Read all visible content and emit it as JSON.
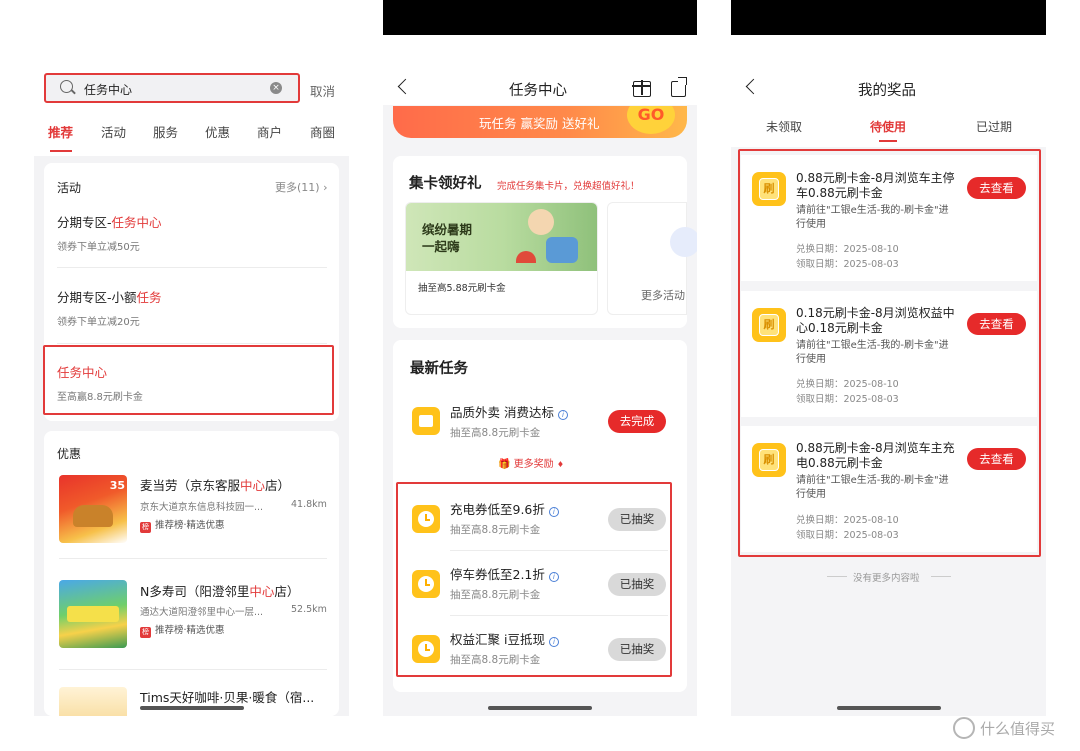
{
  "panel1": {
    "search": {
      "query": "任务中心",
      "cancel": "取消"
    },
    "tabs": [
      "推荐",
      "活动",
      "服务",
      "优惠",
      "商户",
      "商圈"
    ],
    "activity": {
      "title": "活动",
      "more": "更多(11)",
      "items": [
        {
          "title_a": "分期专区-",
          "title_hl": "任务中心",
          "title_b": "",
          "sub": "领券下单立减50元"
        },
        {
          "title_a": "分期专区-小额",
          "title_hl": "任务",
          "title_b": "",
          "sub": "领券下单立减20元"
        },
        {
          "title_a": "",
          "title_hl": "任务中心",
          "title_b": "",
          "sub": "至高赢8.8元刷卡金"
        }
      ]
    },
    "discount": {
      "title": "优惠",
      "shops": [
        {
          "name_a": "麦当劳（京东客服",
          "name_hl": "中心",
          "name_b": "店）",
          "addr": "京东大道京东信息科技园一...",
          "dist": "41.8km",
          "tag": "推荐榜·精选优惠",
          "tag_icon": "榜"
        },
        {
          "name_a": "N多寿司（阳澄邻里",
          "name_hl": "中心",
          "name_b": "店）",
          "addr": "通达大道阳澄邻里中心一层...",
          "dist": "52.5km",
          "tag": "推荐榜·精选优惠",
          "tag_icon": "榜"
        },
        {
          "name_a": "Tims天好咖啡·贝果·暖食（宿...",
          "name_hl": "",
          "name_b": "",
          "addr": "",
          "dist": "",
          "tag": "",
          "tag_icon": ""
        }
      ]
    }
  },
  "panel2": {
    "nav_title": "任务中心",
    "banner": "玩任务 赢奖励 送好礼",
    "banner_go": "GO",
    "collect": {
      "title": "集卡领好礼",
      "subtitle": "完成任务集卡片，兑换超值好礼！",
      "card_title_1": "缤纷暑期",
      "card_title_2": "一起嗨",
      "card_sub": "抽至高5.88元刷卡金",
      "more": "更多活动"
    },
    "latest": {
      "title": "最新任务",
      "tasks": [
        {
          "name": "品质外卖 消费达标",
          "sub": "抽至高8.8元刷卡金",
          "button": "去完成",
          "state": "active",
          "icon": "bag-icon"
        },
        {
          "name": "充电券低至9.6折",
          "sub": "抽至高8.8元刷卡金",
          "button": "已抽奖",
          "state": "done",
          "icon": "clock-icon"
        },
        {
          "name": "停车券低至2.1折",
          "sub": "抽至高8.8元刷卡金",
          "button": "已抽奖",
          "state": "done",
          "icon": "clock-icon"
        },
        {
          "name": "权益汇聚 i豆抵现",
          "sub": "抽至高8.8元刷卡金",
          "button": "已抽奖",
          "state": "done",
          "icon": "clock-icon"
        }
      ],
      "more_rewards": "更多奖励"
    }
  },
  "panel3": {
    "nav_title": "我的奖品",
    "tabs": [
      "未领取",
      "待使用",
      "已过期"
    ],
    "active_tab": 1,
    "prizes": [
      {
        "title": "0.88元刷卡金-8月浏览车主停车0.88元刷卡金",
        "desc": "请前往\"工银e生活-我的-刷卡金\"进行使用",
        "exchange": "兑换日期：2025-08-10",
        "receive": "领取日期：2025-08-03",
        "button": "去查看",
        "icon": "刷"
      },
      {
        "title": "0.18元刷卡金-8月浏览权益中心0.18元刷卡金",
        "desc": "请前往\"工银e生活-我的-刷卡金\"进行使用",
        "exchange": "兑换日期：2025-08-10",
        "receive": "领取日期：2025-08-03",
        "button": "去查看",
        "icon": "刷"
      },
      {
        "title": "0.88元刷卡金-8月浏览车主充电0.88元刷卡金",
        "desc": "请前往\"工银e生活-我的-刷卡金\"进行使用",
        "exchange": "兑换日期：2025-08-10",
        "receive": "领取日期：2025-08-03",
        "button": "去查看",
        "icon": "刷"
      }
    ],
    "no_more": "没有更多内容啦"
  },
  "watermark": "什么值得买",
  "colors": {
    "accent": "#e23a3a",
    "button_red": "#e62a2a",
    "icon_yellow": "#ffc21a"
  }
}
